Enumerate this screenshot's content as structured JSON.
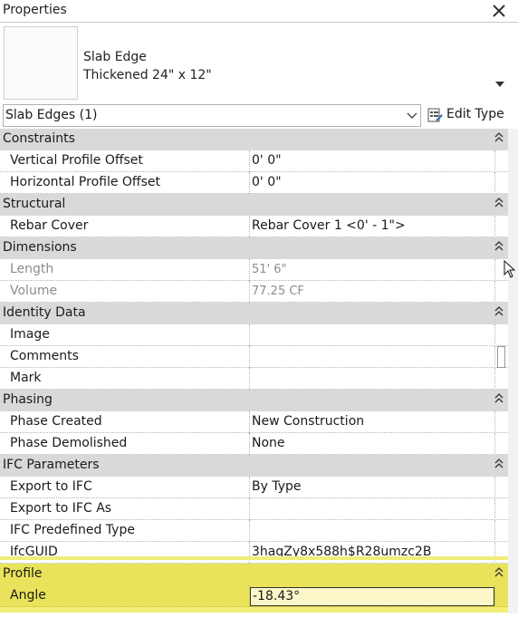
{
  "window": {
    "title": "Properties"
  },
  "type_selector": {
    "family": "Slab Edge",
    "type": "Thickened 24\" x 12\""
  },
  "instance_selector": {
    "value": "Slab Edges (1)"
  },
  "edit_type": {
    "label": "Edit Type"
  },
  "groups": {
    "constraints": {
      "title": "Constraints",
      "rows": [
        {
          "name": "Vertical Profile Offset",
          "value": "0'  0\""
        },
        {
          "name": "Horizontal Profile Offset",
          "value": "0'  0\""
        }
      ]
    },
    "structural": {
      "title": "Structural",
      "rows": [
        {
          "name": "Rebar Cover",
          "value": "Rebar Cover 1 <0' - 1\">"
        }
      ]
    },
    "dimensions": {
      "title": "Dimensions",
      "rows": [
        {
          "name": "Length",
          "value": "51'  6\""
        },
        {
          "name": "Volume",
          "value": "77.25 CF"
        }
      ]
    },
    "identity": {
      "title": "Identity Data",
      "rows": [
        {
          "name": "Image",
          "value": ""
        },
        {
          "name": "Comments",
          "value": ""
        },
        {
          "name": "Mark",
          "value": ""
        }
      ]
    },
    "phasing": {
      "title": "Phasing",
      "rows": [
        {
          "name": "Phase Created",
          "value": "New Construction"
        },
        {
          "name": "Phase Demolished",
          "value": "None"
        }
      ]
    },
    "ifc": {
      "title": "IFC Parameters",
      "rows": [
        {
          "name": "Export to IFC",
          "value": "By Type"
        },
        {
          "name": "Export to IFC As",
          "value": ""
        },
        {
          "name": "IFC Predefined Type",
          "value": ""
        },
        {
          "name": "IfcGUID",
          "value": "3haqZy8x588h$R28umzc2B"
        }
      ]
    },
    "profile": {
      "title": "Profile",
      "rows": [
        {
          "name": "Angle",
          "value": "-18.43°"
        }
      ]
    }
  },
  "colors": {
    "highlight": "#e8e35a",
    "group_header": "#d9d9d9",
    "readonly_text": "#8c8c8c"
  },
  "icons": [
    "close-icon",
    "dropdown-arrow-icon",
    "chevron-down-icon",
    "edit-type-icon",
    "collapse-icon",
    "mouse-pointer-icon"
  ]
}
